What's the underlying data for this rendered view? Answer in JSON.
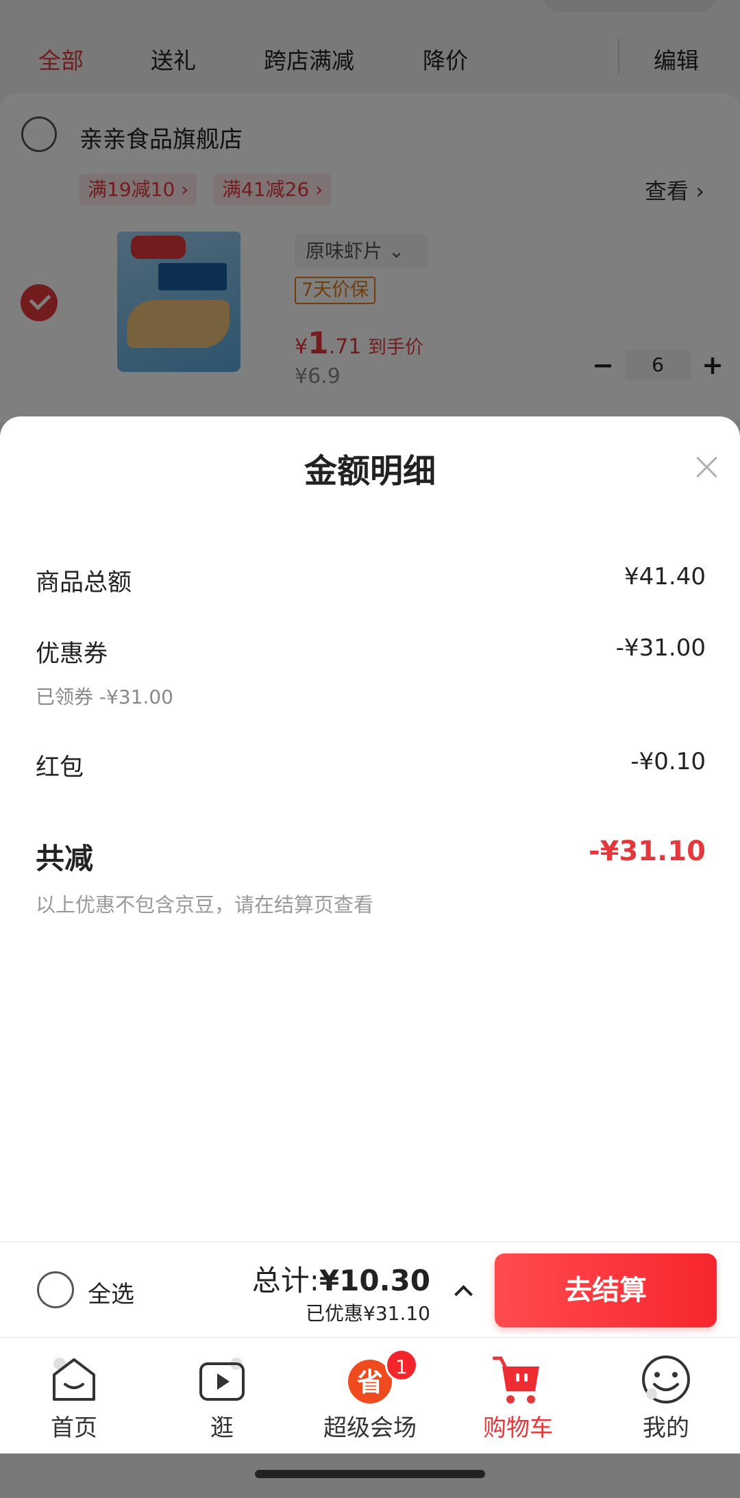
{
  "filter_tabs": [
    "全部",
    "送礼",
    "跨店满减",
    "降价"
  ],
  "edit_label": "编辑",
  "store": {
    "name": "亲亲食品旗舰店",
    "coupons": [
      "满19减10 ›",
      "满41减26 ›"
    ],
    "see_label": "查看 ›"
  },
  "product": {
    "spec": "原味虾片  ⌄",
    "guarantee": "7天价保",
    "price_symbol": "¥",
    "price_int": "1",
    "price_dec": ".71",
    "price_suffix": "到手价",
    "original_price": "¥6.9",
    "quantity": "6",
    "minus": "−",
    "plus": "+"
  },
  "sheet": {
    "title": "金额明细",
    "rows": [
      {
        "label": "商品总额",
        "value": "¥41.40"
      },
      {
        "label": "优惠券",
        "value": "-¥31.00",
        "sub": "已领券 -¥31.00"
      },
      {
        "label": "红包",
        "value": "-¥0.10"
      }
    ],
    "total_label": "共减",
    "total_value": "-¥31.10",
    "note": "以上优惠不包含京豆，请在结算页查看"
  },
  "checkout": {
    "select_all": "全选",
    "total_prefix": "总计:",
    "total_amount": "¥10.30",
    "saved": "已优惠¥31.10",
    "button": "去结算"
  },
  "tabbar": {
    "items": [
      {
        "label": "首页",
        "icon": "home-icon"
      },
      {
        "label": "逛",
        "icon": "play-icon"
      },
      {
        "label": "超级会场",
        "icon": "super-venue-icon",
        "badge": "1"
      },
      {
        "label": "购物车",
        "icon": "cart-icon",
        "active": true
      },
      {
        "label": "我的",
        "icon": "smile-icon"
      }
    ]
  },
  "colors": {
    "accent": "#e4393c",
    "checkout_button": "#f7262e"
  }
}
